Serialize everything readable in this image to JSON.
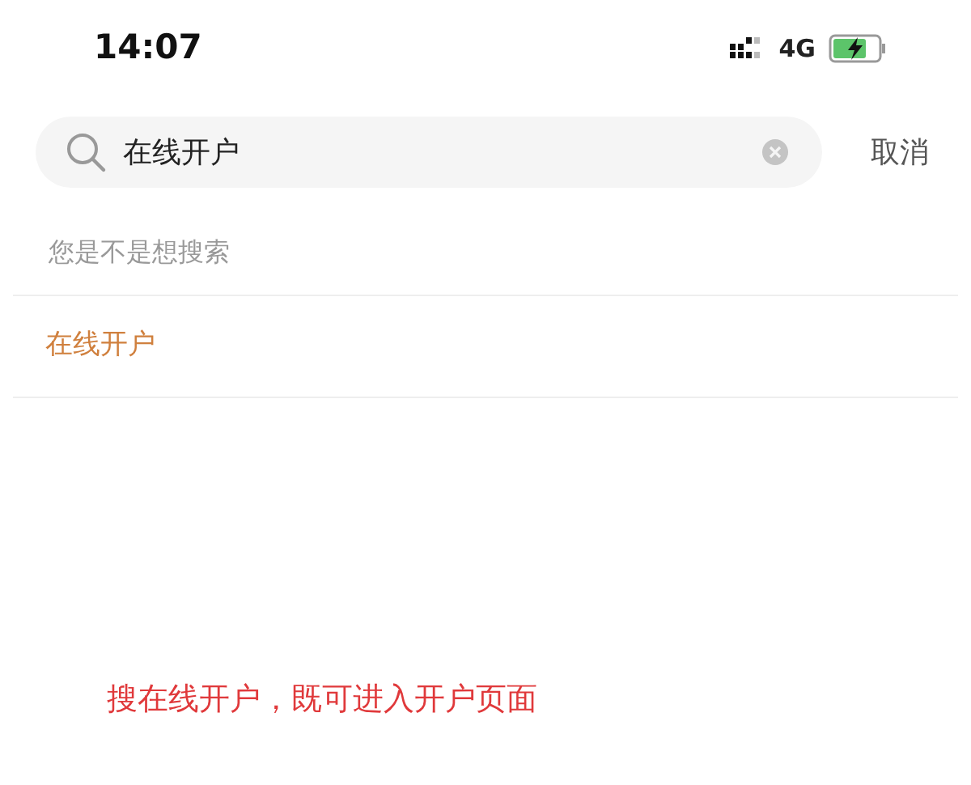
{
  "status_bar": {
    "time": "14:07",
    "network": "4G",
    "charging": true
  },
  "search": {
    "value": "在线开户",
    "cancel": "取消"
  },
  "suggestions": {
    "heading": "您是不是想搜索",
    "items": [
      {
        "label": "在线开户"
      }
    ]
  },
  "annotation": "搜在线开户，既可进入开户页面"
}
